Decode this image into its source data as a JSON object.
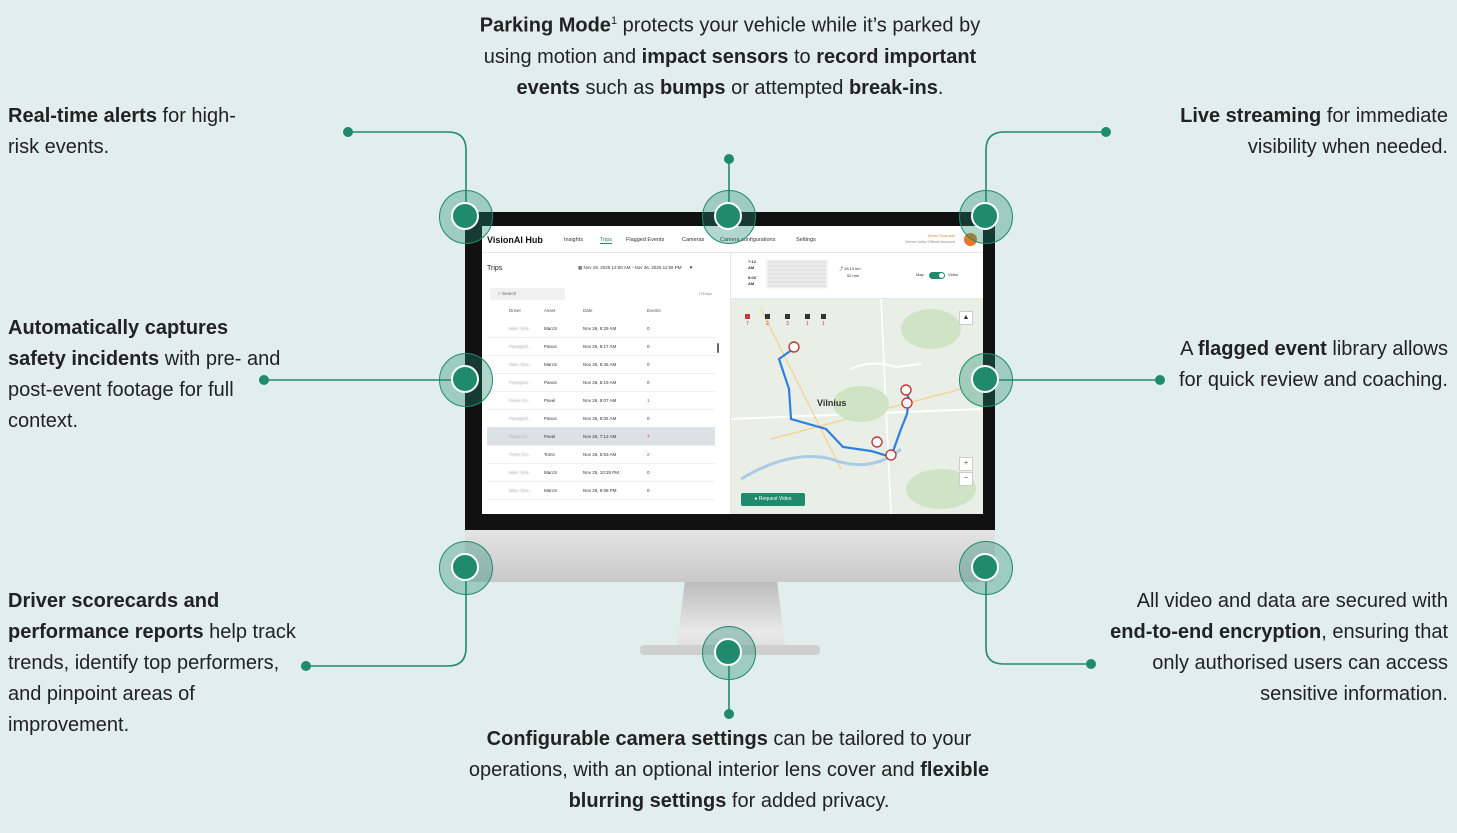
{
  "callouts": {
    "top_center": {
      "b1": "Parking Mode",
      "sup": "1",
      "t1": " protects your vehicle while it’s parked by using motion and ",
      "b2": "impact sensors",
      "t2": " to ",
      "b3": "record important events",
      "t3": " such as ",
      "b4": "bumps",
      "t4": " or attempted ",
      "b5": "break-ins",
      "t5": "."
    },
    "top_left": {
      "b1": "Real-time alerts",
      "t1": " for high-risk events."
    },
    "top_right": {
      "b1": "Live streaming",
      "t1": " for immediate visibility when needed."
    },
    "mid_left": {
      "b1": "Automatically captures safety incidents",
      "t1": " with pre- and post-event footage for full context."
    },
    "mid_right": {
      "t0": "A ",
      "b1": "flagged event",
      "t1": " library allows for quick review and coaching."
    },
    "bottom_left": {
      "b1": "Driver scorecards and performance reports",
      "t1": " help track trends, identify top performers, and pinpoint areas of improvement."
    },
    "bottom_right": {
      "t0": "All video and data are secured with ",
      "b1": "end-to-end encryption",
      "t1": ", ensuring that only authorised users can access sensitive information."
    },
    "bottom_center": {
      "b1": "Configurable camera settings",
      "t1": " can be tailored to your operations, with an optional interior lens cover and ",
      "b2": "flexible blurring settings",
      "t2": " for added privacy."
    }
  },
  "app": {
    "brand": "VisionAI Hub",
    "tabs": [
      "Insights",
      "Trips",
      "Flagged Events",
      "Cameras",
      "Camera configurations",
      "Settings"
    ],
    "active_tab": "Trips",
    "account_user": "Demo Example",
    "account_name": "Demo Unity Official Account",
    "trips_title": "Trips",
    "date_range": "Nov 19, 2025 12:00 AM - Nov 26, 2025 11:59 PM",
    "search_placeholder": "Search",
    "trip_count": "178 trips",
    "columns": [
      "Driver",
      "Asset",
      "Date",
      "Events"
    ],
    "rows": [
      {
        "driver": "Marc Stra...",
        "asset": "MarcS",
        "date": "Nov 26, 9:29 AM",
        "events": "0"
      },
      {
        "driver": "Panagioti...",
        "asset": "Panos",
        "date": "Nov 26, 9:17 AM",
        "events": "0"
      },
      {
        "driver": "Marc Stra...",
        "asset": "MarcS",
        "date": "Nov 26, 8:45 AM",
        "events": "0"
      },
      {
        "driver": "Panagioti...",
        "asset": "Panos",
        "date": "Nov 26, 8:19 AM",
        "events": "0"
      },
      {
        "driver": "Pavel Cu...",
        "asset": "Pavel",
        "date": "Nov 26, 8:07 AM",
        "events": "1"
      },
      {
        "driver": "Panagioti...",
        "asset": "Panos",
        "date": "Nov 26, 8:05 AM",
        "events": "0"
      },
      {
        "driver": "Pavel Cu...",
        "asset": "Pavel",
        "date": "Nov 26, 7:12 AM",
        "events": "7"
      },
      {
        "driver": "Toms Gru...",
        "asset": "Toms",
        "date": "Nov 26, 5:53 AM",
        "events": "2"
      },
      {
        "driver": "Marc Stra...",
        "asset": "MarcS",
        "date": "Nov 25, 10:25 PM",
        "events": "0"
      },
      {
        "driver": "Marc Stra...",
        "asset": "MarcS",
        "date": "Nov 25, 9:58 PM",
        "events": "0"
      }
    ],
    "trip_start_time": "7:12 AM",
    "trip_end_time": "8:03 AM",
    "trip_distance": "28.19 km",
    "trip_duration": "52 min",
    "map_label": "Map",
    "video_label": "Video",
    "city_label": "Vilnius",
    "request_video": "Request Video",
    "event_counts": [
      "7",
      "2",
      "3",
      "1",
      "1"
    ],
    "zoom_in": "+",
    "zoom_out": "−"
  },
  "colors": {
    "accent": "#1f8a6c",
    "background": "#e2eeeb",
    "event_red": "#d23030"
  }
}
